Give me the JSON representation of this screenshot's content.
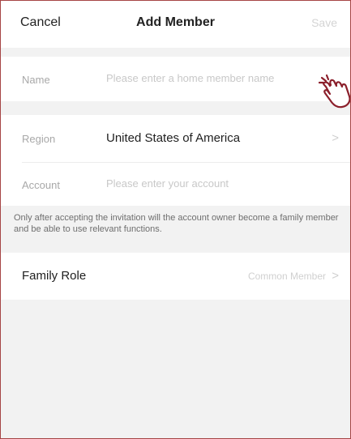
{
  "header": {
    "cancel_label": "Cancel",
    "title": "Add Member",
    "save_label": "Save"
  },
  "form": {
    "name": {
      "label": "Name",
      "placeholder": "Please enter a home member name",
      "value": ""
    },
    "region": {
      "label": "Region",
      "value": "United States of America",
      "chevron": ">"
    },
    "account": {
      "label": "Account",
      "placeholder": "Please enter your account",
      "value": ""
    },
    "note": "Only after accepting the invitation will the account owner become a family member and be able to use relevant functions.",
    "family_role": {
      "label": "Family Role",
      "value": "Common Member",
      "chevron": ">"
    }
  },
  "icons": {
    "pointer": "hand-pointer-icon"
  },
  "colors": {
    "background": "#f2f2f2",
    "card": "#ffffff",
    "frame_border": "#a64545",
    "text_primary": "#1f1f1f",
    "text_muted": "#a8a8a8",
    "cursor_stroke": "#8b1f2b"
  }
}
